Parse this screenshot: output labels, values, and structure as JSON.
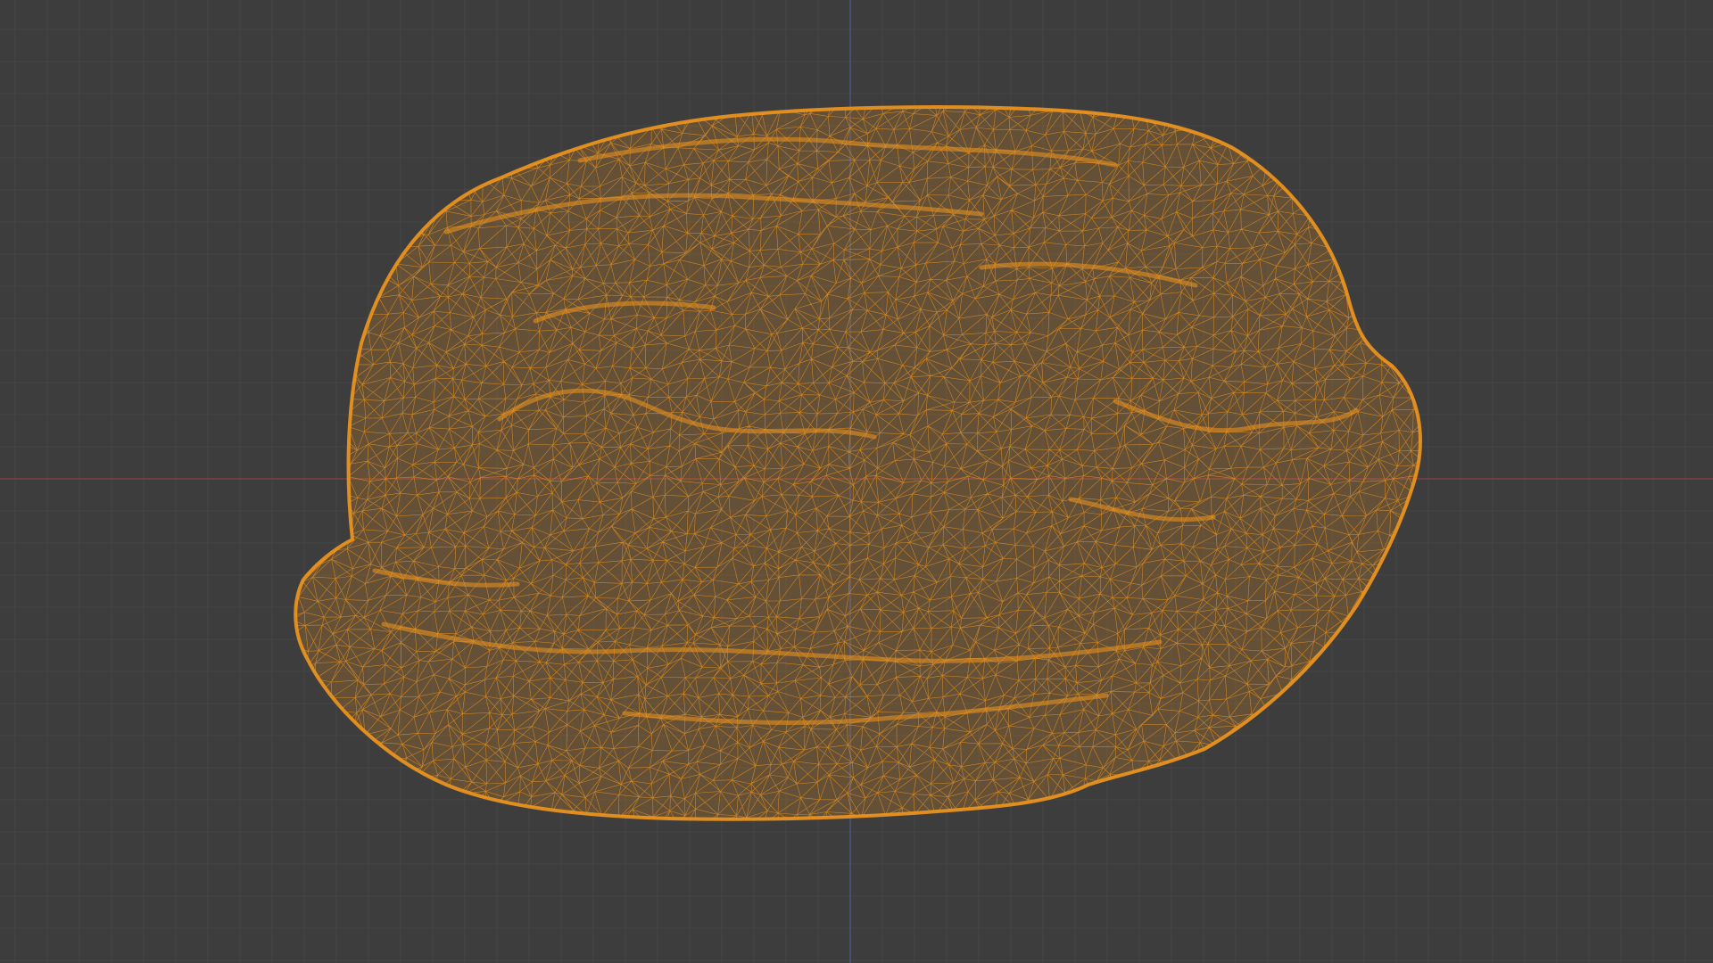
{
  "viewport": {
    "view_mode": "wireframe",
    "projection": "orthographic",
    "background_color": "#3d3d3d",
    "grid_minor_color": "#454545",
    "grid_major_color": "#4d4d4d",
    "x_axis_color": "#8a4048",
    "z_axis_color": "#4b5a8c"
  },
  "object": {
    "name": "",
    "selected": true,
    "wire_color": "#f0961e",
    "shape": "irregular rounded scanned mesh"
  }
}
